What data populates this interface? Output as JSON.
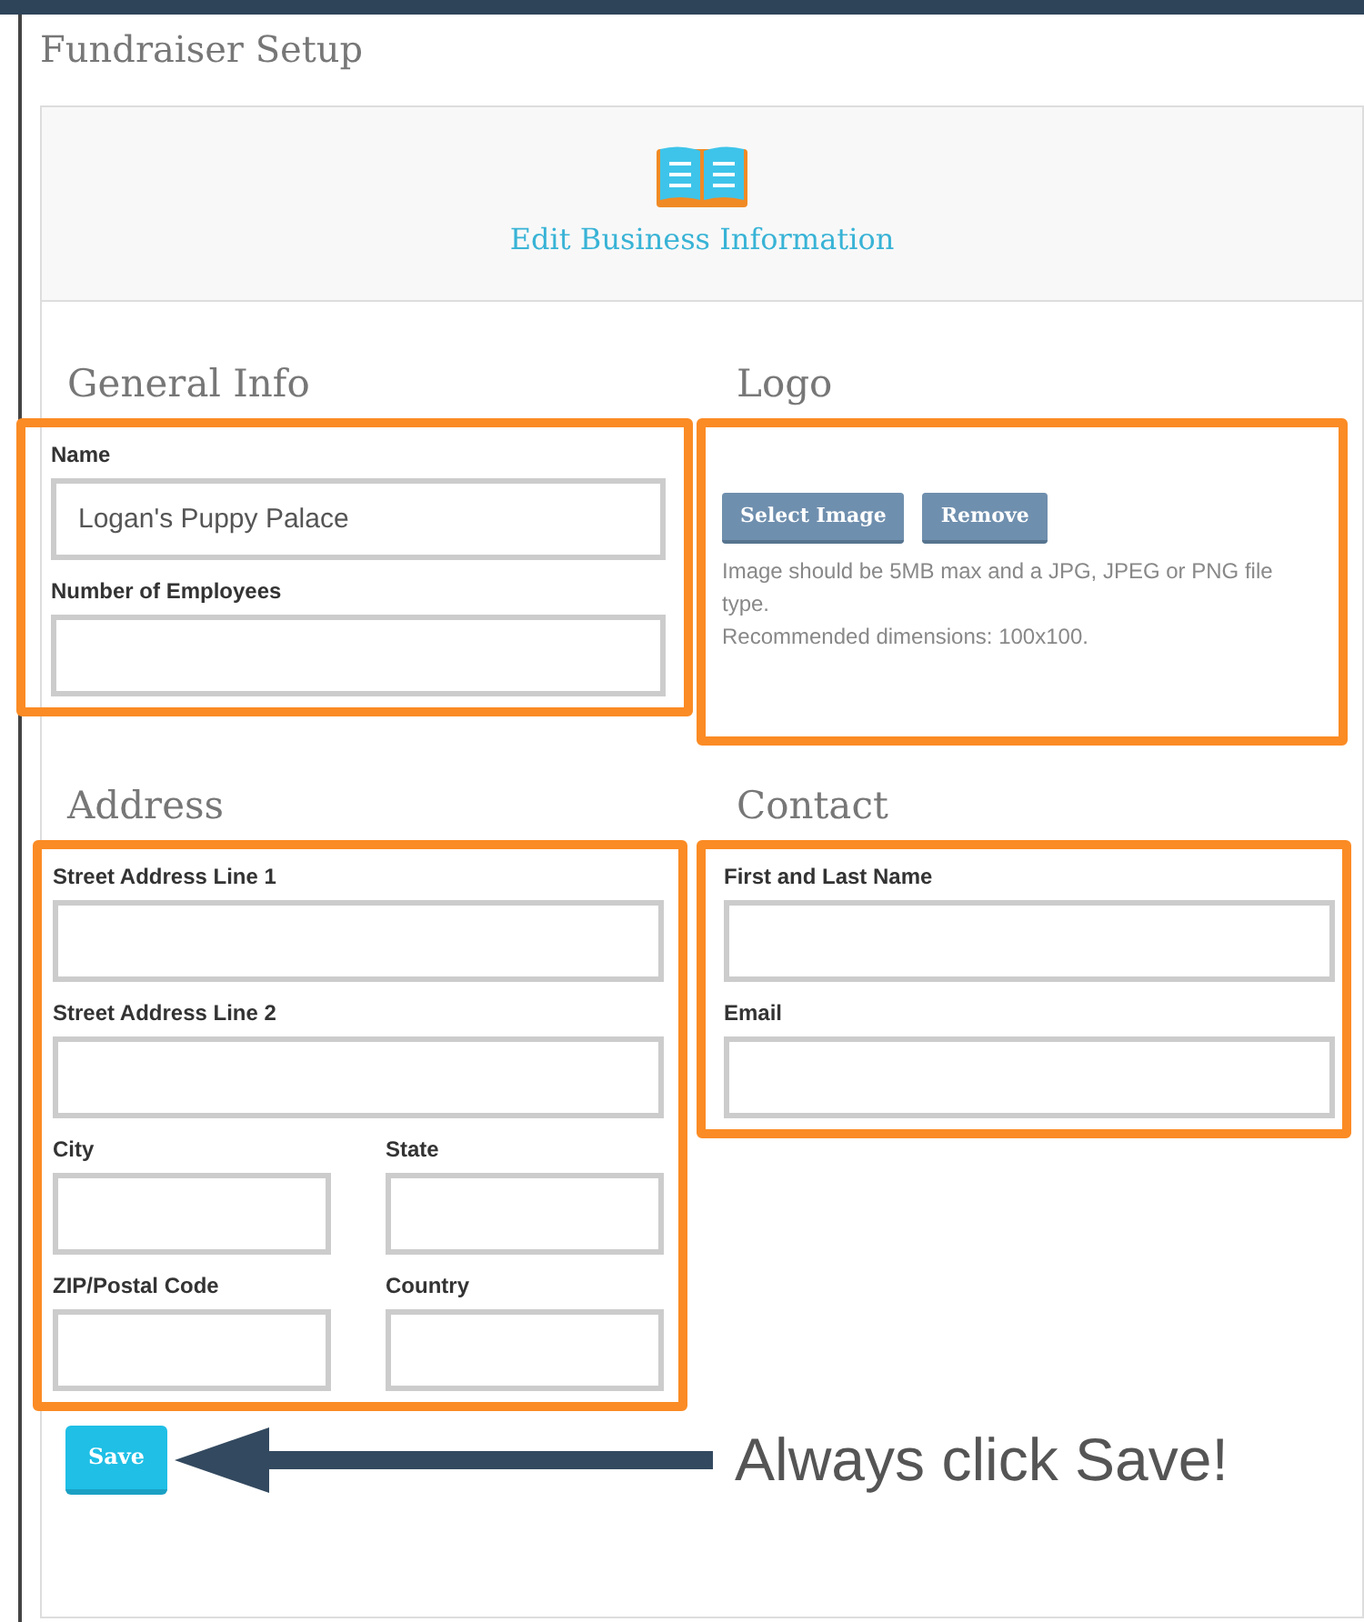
{
  "page_title": "Fundraiser Setup",
  "header": {
    "title": "Edit Business Information"
  },
  "general_info": {
    "title": "General Info",
    "rows": [
      [
        {
          "label": "Name",
          "value": "Logan's Puppy Palace"
        }
      ],
      [
        {
          "label": "Number of Employees"
        }
      ]
    ]
  },
  "logo": {
    "title": "Logo",
    "buttons": [
      "Select Image",
      "Remove"
    ],
    "help": [
      "Image should be 5MB max and a JPG, JPEG or PNG file type.",
      "Recommended dimensions: 100x100."
    ]
  },
  "address": {
    "title": "Address",
    "rows": [
      [
        {
          "label": "Street Address Line 1"
        }
      ],
      [
        {
          "label": "Street Address Line 2"
        }
      ],
      [
        {
          "label": "City"
        },
        {
          "label": "State"
        }
      ],
      [
        {
          "label": "ZIP/Postal Code"
        },
        {
          "label": "Country"
        }
      ]
    ]
  },
  "contact": {
    "title": "Contact",
    "rows": [
      [
        {
          "label": "First and Last Name"
        }
      ],
      [
        {
          "label": "Email"
        }
      ]
    ]
  },
  "save_button": "Save",
  "annotation": "Always click Save!"
}
